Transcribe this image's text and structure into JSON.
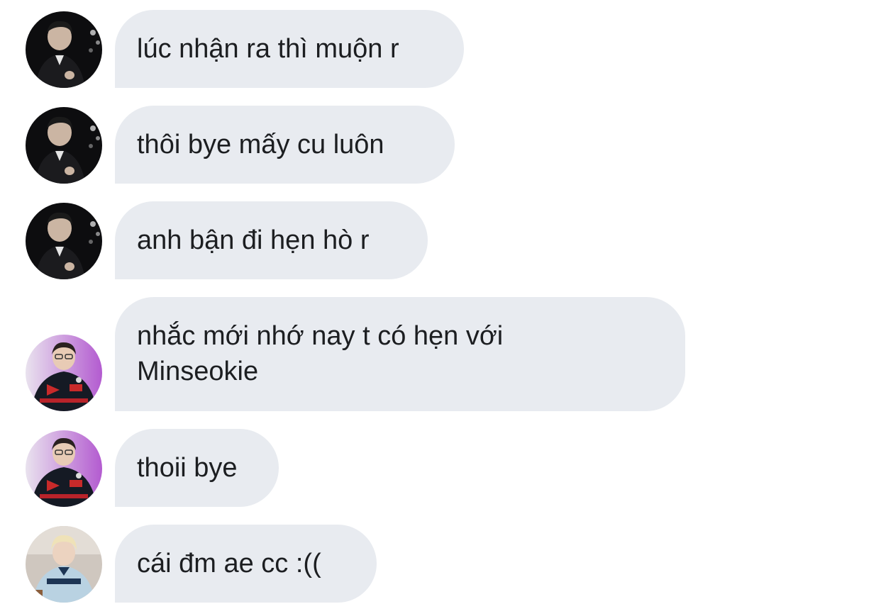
{
  "messages": [
    {
      "text": "lúc nhận ra thì muộn r",
      "avatar": "user-dark-suit"
    },
    {
      "text": "thôi bye mấy cu luôn",
      "avatar": "user-dark-suit"
    },
    {
      "text": "anh bận đi hẹn hò r",
      "avatar": "user-dark-suit"
    },
    {
      "text": "nhắc mới nhớ nay t có hẹn với\nMinseokie",
      "avatar": "user-glasses-jersey"
    },
    {
      "text": "thoii bye",
      "avatar": "user-glasses-jersey"
    },
    {
      "text": "cái đm ae cc :((",
      "avatar": "user-blonde-jersey"
    }
  ],
  "colors": {
    "bubble_bg": "#e8ebf0",
    "text": "#1c1e21",
    "background": "#ffffff"
  }
}
